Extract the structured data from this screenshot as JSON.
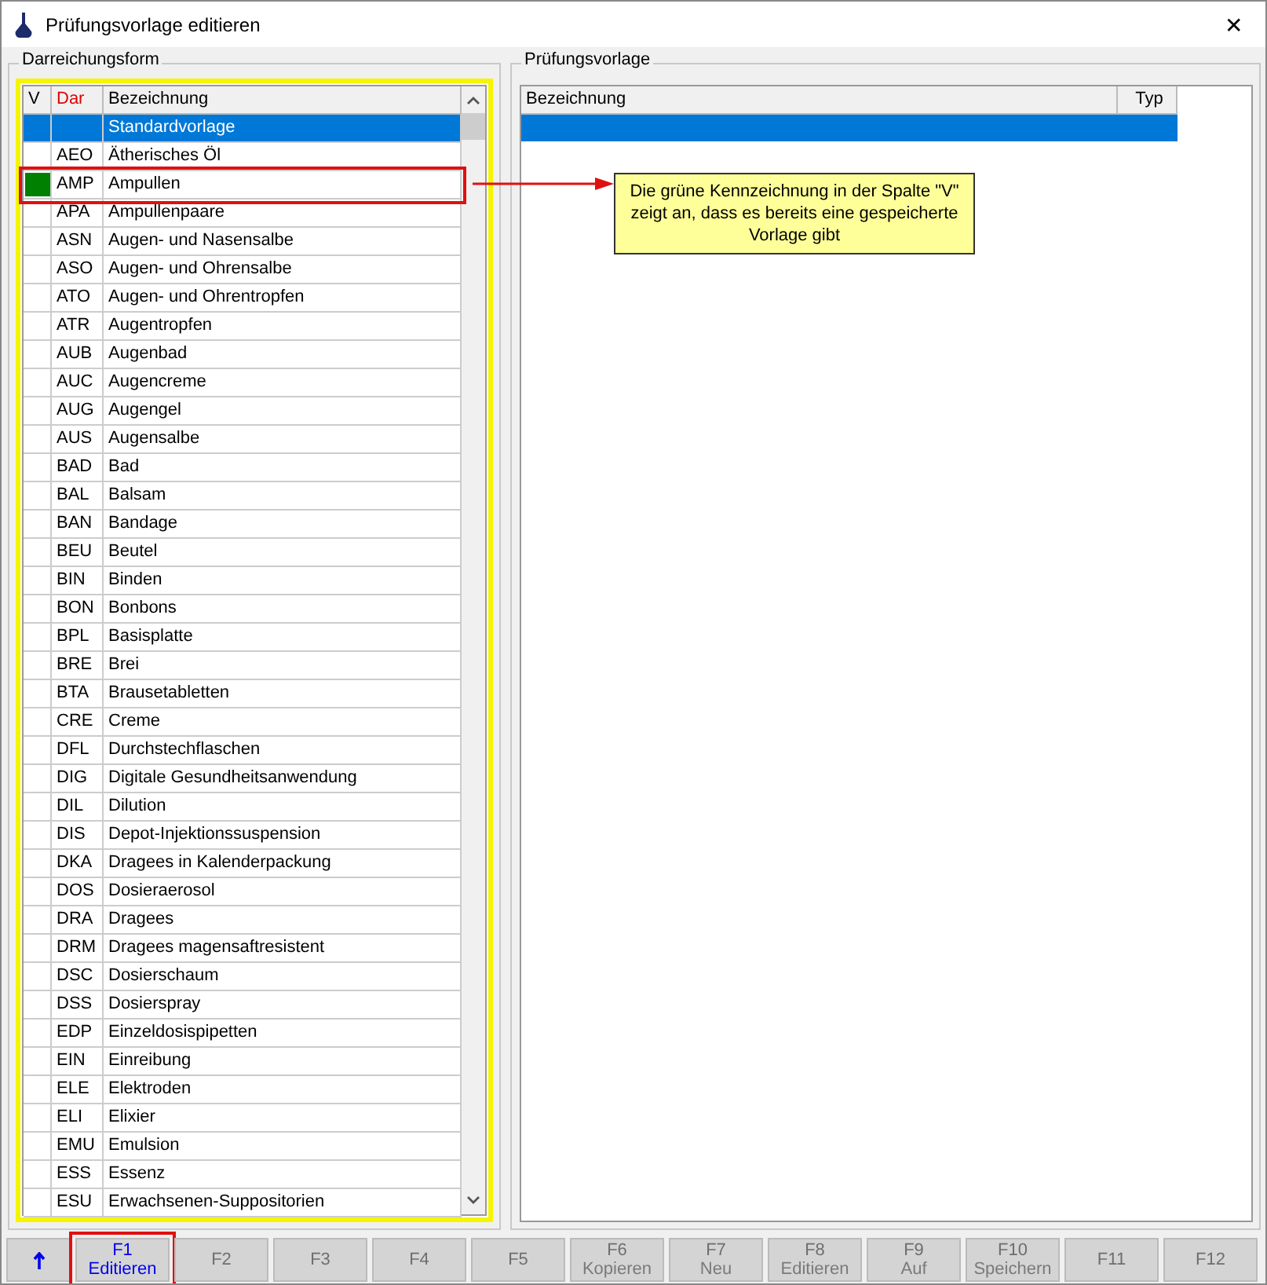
{
  "window": {
    "title": "Prüfungsvorlage editieren",
    "close": "✕"
  },
  "left_panel": {
    "title": "Darreichungsform",
    "columns": [
      "V",
      "Dar",
      "Bezeichnung"
    ],
    "rows": [
      {
        "saved": false,
        "code": "",
        "name": "Standardvorlage",
        "selected": true,
        "highlighted": false
      },
      {
        "saved": false,
        "code": "AEO",
        "name": "Ätherisches Öl",
        "selected": false,
        "highlighted": false
      },
      {
        "saved": true,
        "code": "AMP",
        "name": "Ampullen",
        "selected": false,
        "highlighted": true
      },
      {
        "saved": false,
        "code": "APA",
        "name": "Ampullenpaare",
        "selected": false,
        "highlighted": false
      },
      {
        "saved": false,
        "code": "ASN",
        "name": "Augen- und Nasensalbe",
        "selected": false,
        "highlighted": false
      },
      {
        "saved": false,
        "code": "ASO",
        "name": "Augen- und Ohrensalbe",
        "selected": false,
        "highlighted": false
      },
      {
        "saved": false,
        "code": "ATO",
        "name": "Augen- und Ohrentropfen",
        "selected": false,
        "highlighted": false
      },
      {
        "saved": false,
        "code": "ATR",
        "name": "Augentropfen",
        "selected": false,
        "highlighted": false
      },
      {
        "saved": false,
        "code": "AUB",
        "name": "Augenbad",
        "selected": false,
        "highlighted": false
      },
      {
        "saved": false,
        "code": "AUC",
        "name": "Augencreme",
        "selected": false,
        "highlighted": false
      },
      {
        "saved": false,
        "code": "AUG",
        "name": "Augengel",
        "selected": false,
        "highlighted": false
      },
      {
        "saved": false,
        "code": "AUS",
        "name": "Augensalbe",
        "selected": false,
        "highlighted": false
      },
      {
        "saved": false,
        "code": "BAD",
        "name": "Bad",
        "selected": false,
        "highlighted": false
      },
      {
        "saved": false,
        "code": "BAL",
        "name": "Balsam",
        "selected": false,
        "highlighted": false
      },
      {
        "saved": false,
        "code": "BAN",
        "name": "Bandage",
        "selected": false,
        "highlighted": false
      },
      {
        "saved": false,
        "code": "BEU",
        "name": "Beutel",
        "selected": false,
        "highlighted": false
      },
      {
        "saved": false,
        "code": "BIN",
        "name": "Binden",
        "selected": false,
        "highlighted": false
      },
      {
        "saved": false,
        "code": "BON",
        "name": "Bonbons",
        "selected": false,
        "highlighted": false
      },
      {
        "saved": false,
        "code": "BPL",
        "name": "Basisplatte",
        "selected": false,
        "highlighted": false
      },
      {
        "saved": false,
        "code": "BRE",
        "name": "Brei",
        "selected": false,
        "highlighted": false
      },
      {
        "saved": false,
        "code": "BTA",
        "name": "Brausetabletten",
        "selected": false,
        "highlighted": false
      },
      {
        "saved": false,
        "code": "CRE",
        "name": "Creme",
        "selected": false,
        "highlighted": false
      },
      {
        "saved": false,
        "code": "DFL",
        "name": "Durchstechflaschen",
        "selected": false,
        "highlighted": false
      },
      {
        "saved": false,
        "code": "DIG",
        "name": "Digitale Gesundheitsanwendung",
        "selected": false,
        "highlighted": false
      },
      {
        "saved": false,
        "code": "DIL",
        "name": "Dilution",
        "selected": false,
        "highlighted": false
      },
      {
        "saved": false,
        "code": "DIS",
        "name": "Depot-Injektionssuspension",
        "selected": false,
        "highlighted": false
      },
      {
        "saved": false,
        "code": "DKA",
        "name": "Dragees in Kalenderpackung",
        "selected": false,
        "highlighted": false
      },
      {
        "saved": false,
        "code": "DOS",
        "name": "Dosieraerosol",
        "selected": false,
        "highlighted": false
      },
      {
        "saved": false,
        "code": "DRA",
        "name": "Dragees",
        "selected": false,
        "highlighted": false
      },
      {
        "saved": false,
        "code": "DRM",
        "name": "Dragees magensaftresistent",
        "selected": false,
        "highlighted": false
      },
      {
        "saved": false,
        "code": "DSC",
        "name": "Dosierschaum",
        "selected": false,
        "highlighted": false
      },
      {
        "saved": false,
        "code": "DSS",
        "name": "Dosierspray",
        "selected": false,
        "highlighted": false
      },
      {
        "saved": false,
        "code": "EDP",
        "name": "Einzeldosispipetten",
        "selected": false,
        "highlighted": false
      },
      {
        "saved": false,
        "code": "EIN",
        "name": "Einreibung",
        "selected": false,
        "highlighted": false
      },
      {
        "saved": false,
        "code": "ELE",
        "name": "Elektroden",
        "selected": false,
        "highlighted": false
      },
      {
        "saved": false,
        "code": "ELI",
        "name": "Elixier",
        "selected": false,
        "highlighted": false
      },
      {
        "saved": false,
        "code": "EMU",
        "name": "Emulsion",
        "selected": false,
        "highlighted": false
      },
      {
        "saved": false,
        "code": "ESS",
        "name": "Essenz",
        "selected": false,
        "highlighted": false
      },
      {
        "saved": false,
        "code": "ESU",
        "name": "Erwachsenen-Suppositorien",
        "selected": false,
        "highlighted": false
      }
    ]
  },
  "right_panel": {
    "title": "Prüfungsvorlage",
    "columns": [
      "Bezeichnung",
      "Typ"
    ],
    "rows": [
      {
        "selected": true
      }
    ]
  },
  "callout": {
    "text": "Die grüne Kennzeichnung in der Spalte \"V\" zeigt an, dass es bereits eine gespeicherte Vorlage gibt"
  },
  "function_keys": [
    {
      "key": "F1",
      "label": "Editieren",
      "disabled": false,
      "highlighted": true
    },
    {
      "key": "F2",
      "disabled": true,
      "highlighted": false
    },
    {
      "key": "F3",
      "disabled": true,
      "highlighted": false
    },
    {
      "key": "F4",
      "disabled": true,
      "highlighted": false
    },
    {
      "key": "F5",
      "disabled": true,
      "highlighted": false
    },
    {
      "key": "F6",
      "label": "Kopieren",
      "disabled": true,
      "highlighted": false
    },
    {
      "key": "F7",
      "label": "Neu",
      "disabled": true,
      "highlighted": false
    },
    {
      "key": "F8",
      "label": "Editieren",
      "disabled": true,
      "highlighted": false
    },
    {
      "key": "F9",
      "label": "Auf",
      "disabled": true,
      "highlighted": false
    },
    {
      "key": "F10",
      "label": "Speichern",
      "disabled": true,
      "highlighted": false
    },
    {
      "key": "F11",
      "disabled": true,
      "highlighted": false
    },
    {
      "key": "F12",
      "disabled": true,
      "highlighted": false
    }
  ]
}
